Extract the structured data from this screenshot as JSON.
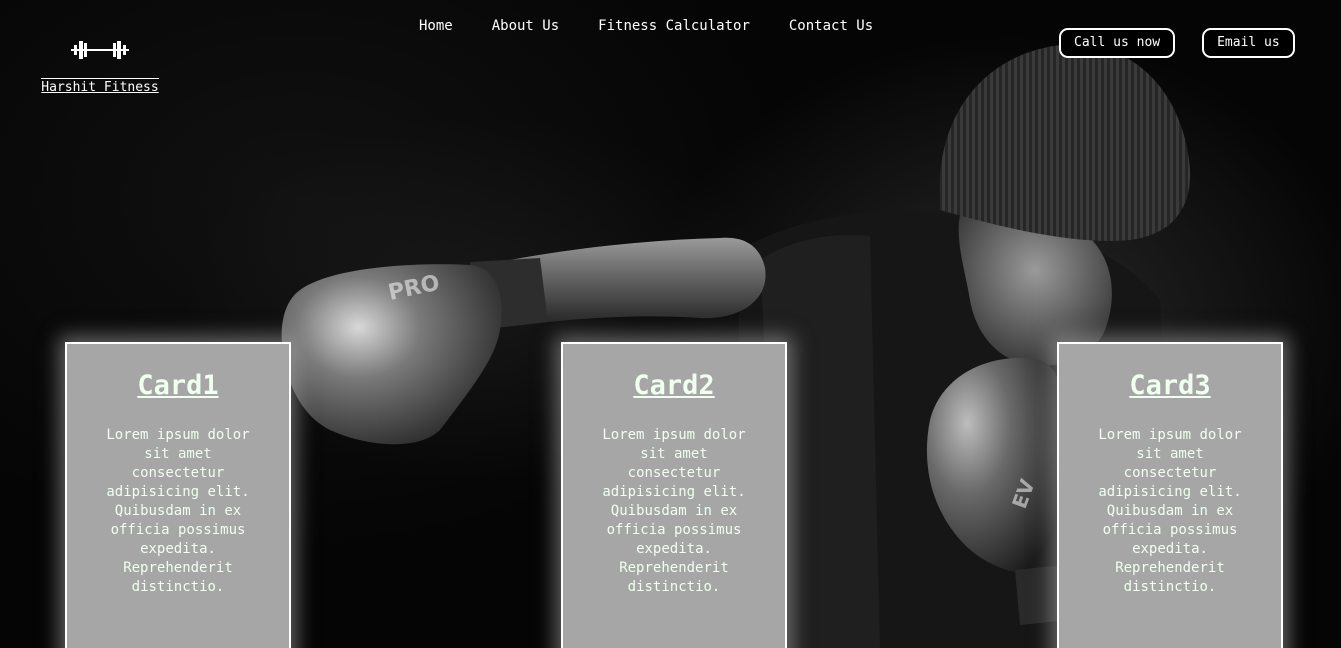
{
  "brand": {
    "name": "Harshit Fitness",
    "icon": "dumbbell-icon"
  },
  "nav": {
    "items": [
      {
        "label": "Home"
      },
      {
        "label": "About Us"
      },
      {
        "label": "Fitness Calculator"
      },
      {
        "label": "Contact Us"
      }
    ]
  },
  "actions": {
    "call_label": "Call us now",
    "email_label": "Email us"
  },
  "cards": [
    {
      "title": "Card1",
      "text": "Lorem ipsum dolor sit amet consectetur adipisicing elit. Quibusdam in ex officia possimus expedita. Reprehenderit distinctio."
    },
    {
      "title": "Card2",
      "text": "Lorem ipsum dolor sit amet consectetur adipisicing elit. Quibusdam in ex officia possimus expedita. Reprehenderit distinctio."
    },
    {
      "title": "Card3",
      "text": "Lorem ipsum dolor sit amet consectetur adipisicing elit. Quibusdam in ex officia possimus expedita. Reprehenderit distinctio."
    }
  ],
  "colors": {
    "background": "#050505",
    "card_background": "#a6a6a6",
    "card_text": "#f0fff0",
    "accent": "#ffffff"
  }
}
